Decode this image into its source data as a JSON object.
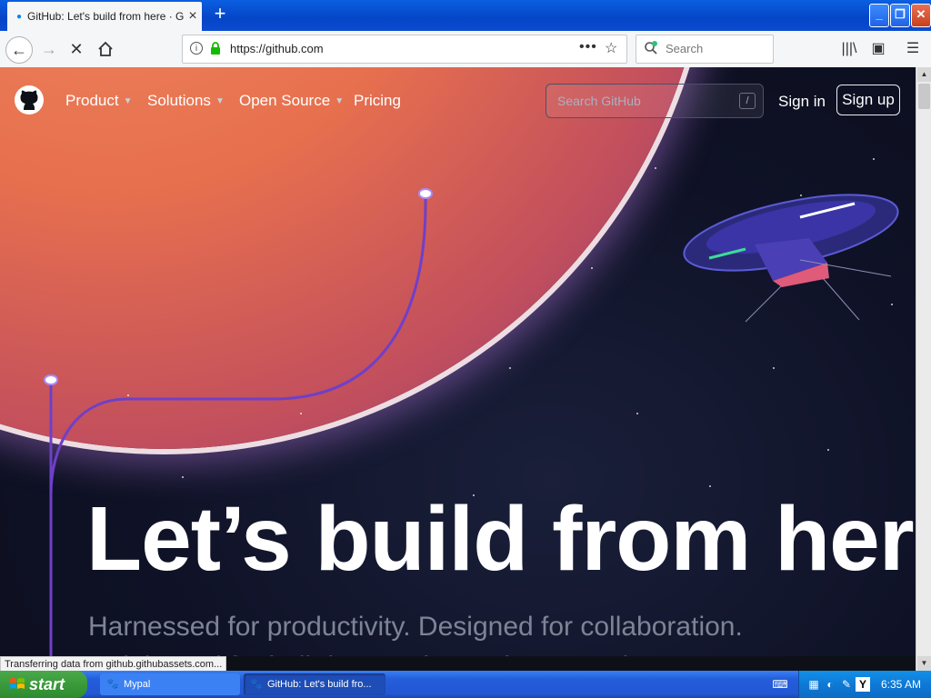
{
  "browser": {
    "tab_title": "GitHub: Let's build from here · GitHub",
    "url": "https://github.com",
    "search_placeholder": "Search",
    "status_text": "Transferring data from github.githubassets.com..."
  },
  "github": {
    "nav": [
      "Product",
      "Solutions",
      "Open Source",
      "Pricing"
    ],
    "search_placeholder": "Search GitHub",
    "search_shortcut": "/",
    "signin": "Sign in",
    "signup": "Sign up",
    "hero_title": "Let’s build from here",
    "hero_subtitle": "Harnessed for productivity. Designed for collaboration. Celebrated for built-in security. Welcome to the"
  },
  "taskbar": {
    "start": "start",
    "items": [
      "Mypal",
      "GitHub: Let's build fro..."
    ],
    "clock": "6:35 AM"
  }
}
